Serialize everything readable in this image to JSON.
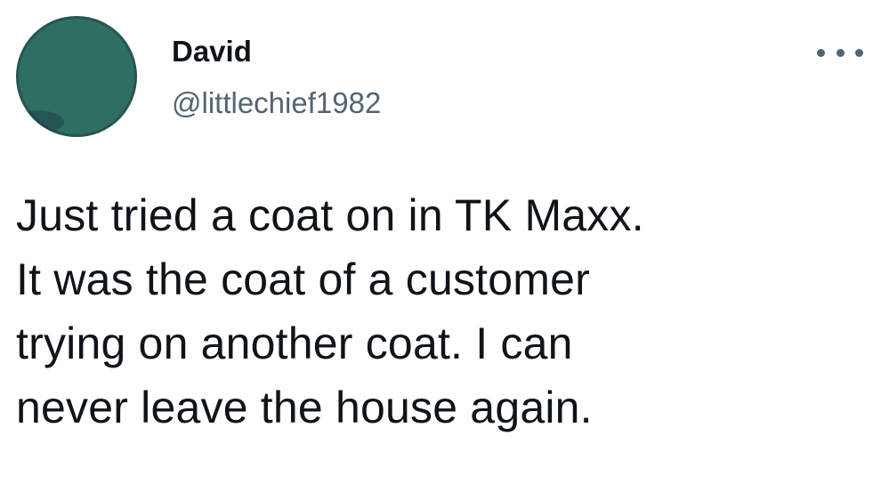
{
  "author": {
    "display_name": "David",
    "handle": "@littlechief1982",
    "avatar_color": "#2f6f63"
  },
  "menu": {
    "icon": "more-horizontal-icon"
  },
  "tweet": {
    "lines": [
      "Just tried a coat on in TK Maxx.",
      "It was the coat of a customer",
      "trying on another coat. I can",
      "never leave the house again."
    ]
  },
  "colors": {
    "text": "#0f1419",
    "secondary": "#536471",
    "background": "#ffffff"
  }
}
